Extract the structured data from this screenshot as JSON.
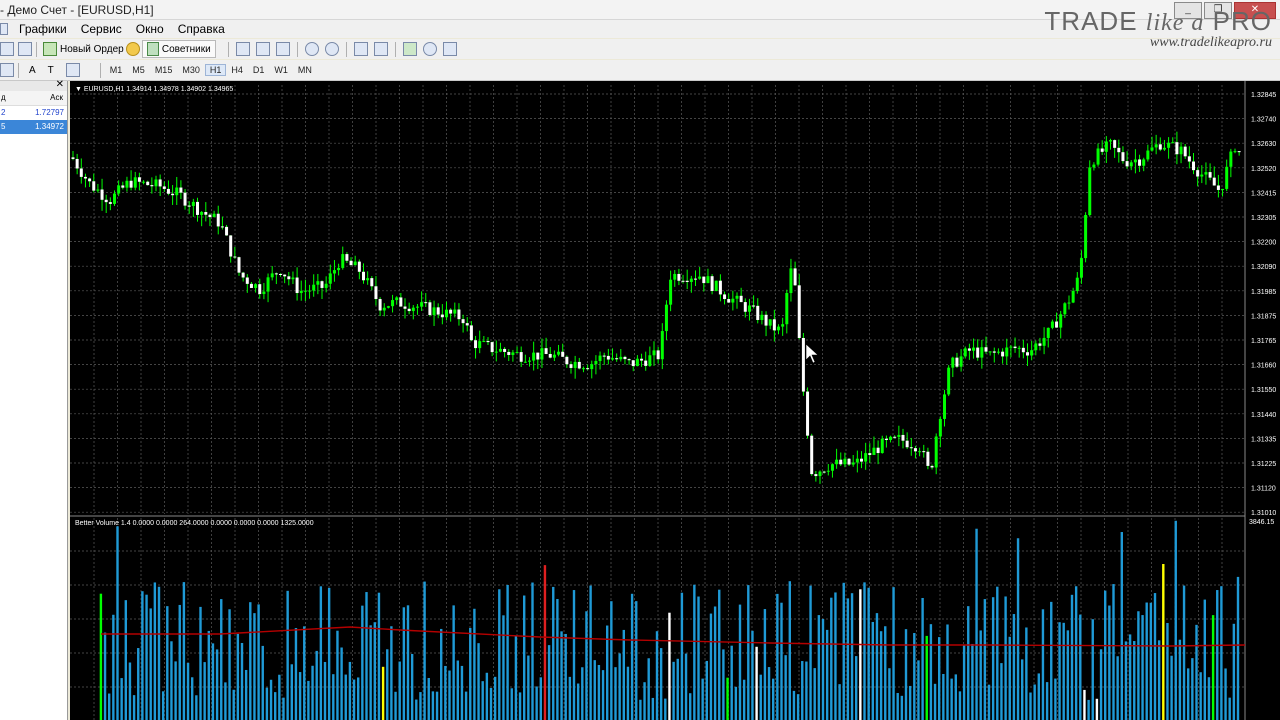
{
  "window": {
    "title": "- Демо Счет - [EURUSD,H1]",
    "controls": [
      "_",
      "❐",
      "✕"
    ]
  },
  "menu": [
    "Графики",
    "Сервис",
    "Окно",
    "Справка"
  ],
  "toolbar": {
    "new_order": "Новый Ордер",
    "experts": "Советники"
  },
  "timeframes": [
    "M1",
    "M5",
    "M15",
    "M30",
    "H1",
    "H4",
    "D1",
    "W1",
    "MN"
  ],
  "active_timeframe": "H1",
  "tools": [
    "A",
    "T"
  ],
  "logo": {
    "text_trade": "TRADE",
    "text_like": "like a",
    "text_pro": "PRO",
    "url": "www.tradelikeapro.ru"
  },
  "market_watch": {
    "col_left": "д",
    "col_ask": "Аск",
    "rows": [
      {
        "sym": "2",
        "ask": "1.72797",
        "selected": false
      },
      {
        "sym": "5",
        "ask": "1.34972",
        "selected": true
      }
    ]
  },
  "chart": {
    "info": "EURUSD,H1  1.34914 1.34978 1.34902 1.34965",
    "price_scale": [
      "1.32845",
      "1.32740",
      "1.32630",
      "1.32520",
      "1.32415",
      "1.32305",
      "1.32200",
      "1.32090",
      "1.31985",
      "1.31875",
      "1.31765",
      "1.31660",
      "1.31550",
      "1.31440",
      "1.31335",
      "1.31225",
      "1.31120",
      "1.31010"
    ],
    "indicator_info": "Better Volume 1.4 0.0000 0.0000 264.0000 0.0000 0.0000 0.0000 1325.0000",
    "indicator_max": "3846.15",
    "colors": {
      "bull": "#00ff00",
      "bear": "#ffffff",
      "grid": "#5a5a5a",
      "vol": "#1f9ad6",
      "ma": "#b40000",
      "climax": "#e02020",
      "churn": "#00ff00",
      "lowvol": "#ffff00",
      "climaxlow": "#ffffff"
    }
  }
}
